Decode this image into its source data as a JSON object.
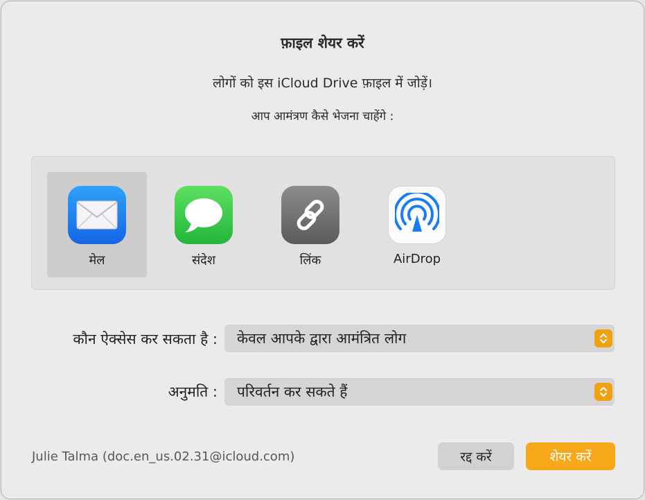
{
  "dialog": {
    "title": "फ़ाइल शेयर करें",
    "subtitle": "लोगों को इस iCloud Drive फ़ाइल में जोड़ें।",
    "question": "आप आमंत्रण कैसे भेजना चाहेंगे :"
  },
  "methods": [
    {
      "label": "मेल",
      "icon": "mail-icon",
      "selected": true
    },
    {
      "label": "संदेश",
      "icon": "messages-icon",
      "selected": false
    },
    {
      "label": "लिंक",
      "icon": "link-icon",
      "selected": false
    },
    {
      "label": "AirDrop",
      "icon": "airdrop-icon",
      "selected": false
    }
  ],
  "access": {
    "label": "कौन ऐक्सेस कर सकता है :",
    "value": "केवल आपके द्वारा आमंत्रित लोग"
  },
  "permission": {
    "label": "अनुमति :",
    "value": "परिवर्तन कर सकते हैं"
  },
  "footer": {
    "user": "Julie Talma (doc.en_us.02.31@icloud.com)",
    "cancel_label": "रद्द करें",
    "share_label": "शेयर करें"
  },
  "colors": {
    "accent": "#f6a81a",
    "mail": "#1e7cf0",
    "messages": "#34c34a",
    "airdrop": "#1a7cf2"
  }
}
